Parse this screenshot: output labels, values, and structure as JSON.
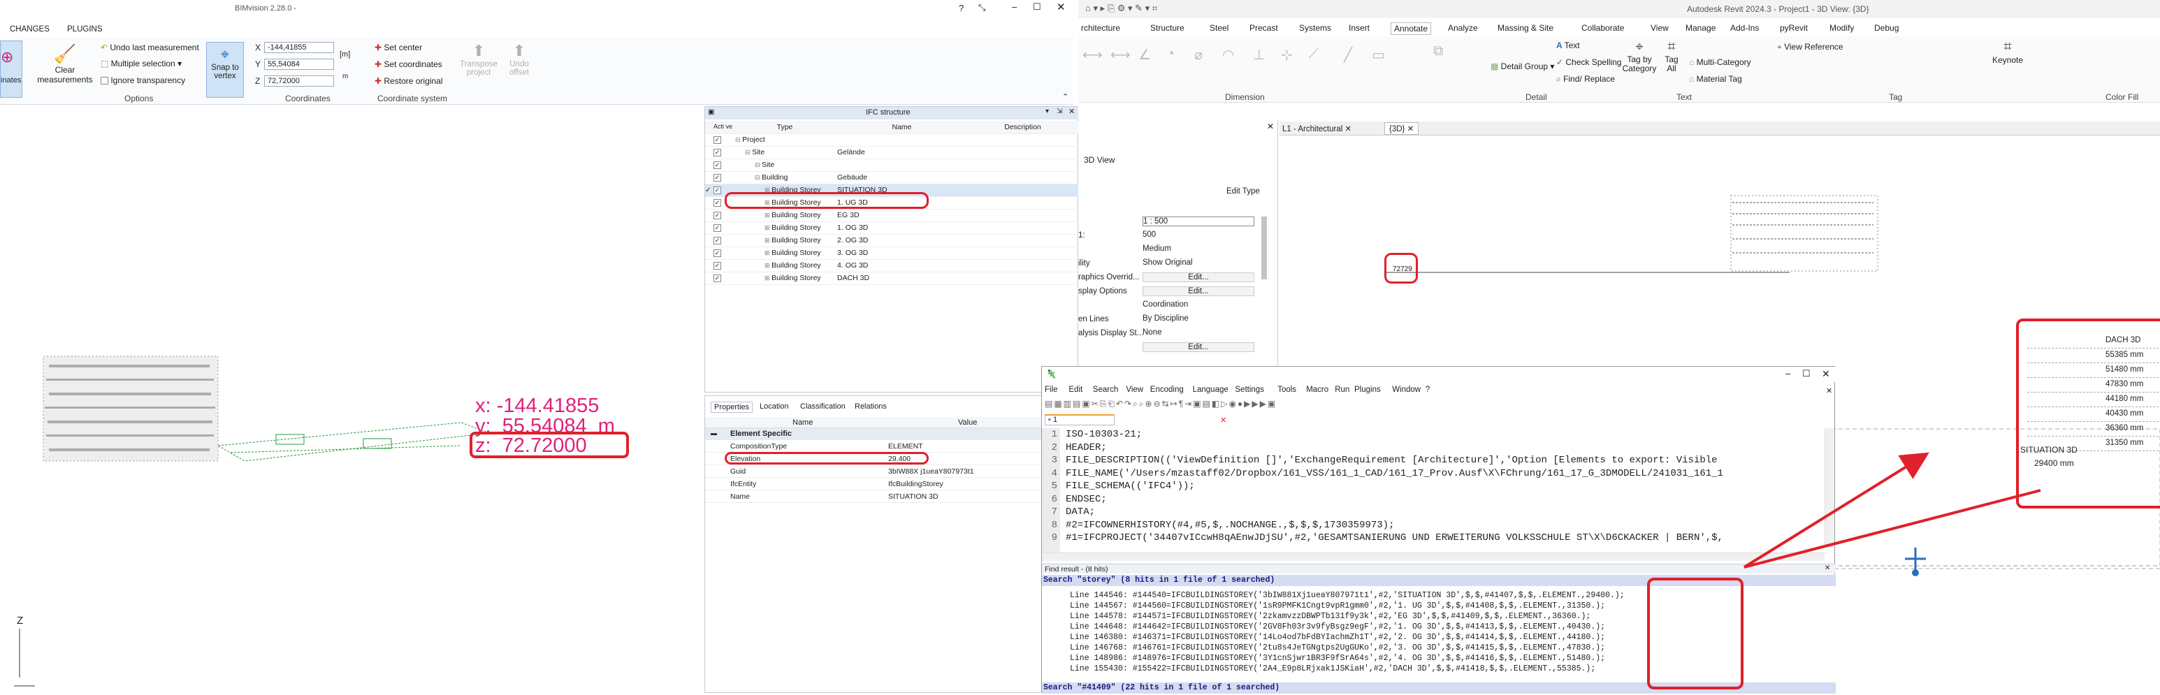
{
  "bim": {
    "title": "BIMvision 2.28.0 -",
    "tabs": [
      "CHANGES",
      "PLUGINS"
    ],
    "win_help": "?",
    "ribbon": {
      "left_cut": "inates",
      "clear_label_1": "Clear",
      "clear_label_2": "measurements",
      "undo_last": "Undo last measurement",
      "multiple_selection": "Multiple selection",
      "ignore_transparency": "Ignore transparency",
      "snap_1": "Snap to",
      "snap_2": "vertex",
      "options_group": "Options",
      "x_label": "X",
      "y_label": "Y",
      "z_label": "Z",
      "x_value": "-144,41855",
      "y_value": "55,54084",
      "z_value": "72,72000",
      "unit": "[m]",
      "unit2": "m",
      "coords_group": "Coordinates",
      "set_center": "Set center",
      "set_coordinates": "Set coordinates",
      "restore_original": "Restore original",
      "transpose_1": "Transpose",
      "transpose_2": "project",
      "undo_offset_1": "Undo",
      "undo_offset_2": "offset",
      "coord_system_group": "Coordinate system"
    },
    "viewport": {
      "coord_x": "x: -144.41855",
      "coord_y": "y:  55.54084  m",
      "coord_z": "z:  72.72000",
      "axis_z": "Z"
    }
  },
  "ifc_structure": {
    "title": "IFC structure",
    "headers": [
      "Acti ve",
      "Type",
      "Name",
      "Description"
    ],
    "rows": [
      {
        "type": "Project",
        "name": "",
        "indent": 0
      },
      {
        "type": "Site",
        "name": "Gelände",
        "indent": 1
      },
      {
        "type": "Site",
        "name": "",
        "indent": 2
      },
      {
        "type": "Building",
        "name": "Gebäude",
        "indent": 2
      },
      {
        "type": "Building Storey",
        "name": "SITUATION 3D",
        "indent": 3
      },
      {
        "type": "Building Storey",
        "name": "1. UG 3D",
        "indent": 3
      },
      {
        "type": "Building Storey",
        "name": "EG 3D",
        "indent": 3
      },
      {
        "type": "Building Storey",
        "name": "1. OG 3D",
        "indent": 3
      },
      {
        "type": "Building Storey",
        "name": "2. OG 3D",
        "indent": 3
      },
      {
        "type": "Building Storey",
        "name": "3. OG 3D",
        "indent": 3
      },
      {
        "type": "Building Storey",
        "name": "4. OG 3D",
        "indent": 3
      },
      {
        "type": "Building Storey",
        "name": "DACH 3D",
        "indent": 3
      }
    ]
  },
  "properties": {
    "tabs": [
      "Properties",
      "Location",
      "Classification",
      "Relations"
    ],
    "headers": [
      "Name",
      "Value"
    ],
    "group": "Element Specific",
    "rows": [
      {
        "name": "CompositionType",
        "value": "ELEMENT"
      },
      {
        "name": "Elevation",
        "value": "29.400"
      },
      {
        "name": "Guid",
        "value": "3bIW88X j1ueaY807973t1"
      },
      {
        "name": "IfcEntity",
        "value": "IfcBuildingStorey"
      },
      {
        "name": "Name",
        "value": "SITUATION 3D"
      }
    ]
  },
  "revit": {
    "title": "Autodesk Revit 2024.3 - Project1 - 3D View: {3D}",
    "menu": [
      "rchitecture",
      "Structure",
      "Steel",
      "Precast",
      "Systems",
      "Insert",
      "Annotate",
      "Analyze",
      "Massing & Site",
      "Collaborate",
      "View",
      "Manage",
      "Add-Ins",
      "pyRevit",
      "Modify",
      "Debug"
    ],
    "ribbon_tags": [
      "Tag by Category",
      "Tag All",
      "Multi-Category",
      "Material Tag",
      "Keynote"
    ],
    "ribbon_text": [
      "Text",
      "Check Spelling",
      "Find/ Replace",
      "View Reference"
    ],
    "detail_group": "Detail Group",
    "group_labels": [
      "Dimension",
      "Detail",
      "Text",
      "Tag",
      "Color Fill"
    ],
    "view_tabs": [
      "L1 - Architectural",
      "{3D}"
    ],
    "props_type": "3D View",
    "edit_type": "Edit Type",
    "props_rows": [
      {
        "label": "",
        "value": "1 : 500"
      },
      {
        "label": "1:",
        "value": "500"
      },
      {
        "label": "",
        "value": "Medium"
      },
      {
        "label": "ility",
        "value": "Show Original"
      },
      {
        "label": "raphics Overrid...",
        "value": "Edit..."
      },
      {
        "label": "splay Options",
        "value": "Edit..."
      },
      {
        "label": "",
        "value": "Coordination"
      },
      {
        "label": "en Lines",
        "value": "By Discipline"
      },
      {
        "label": "alysis Display St...",
        "value": "None"
      },
      {
        "label": "",
        "value": "Edit..."
      }
    ],
    "spot": "72729",
    "levels": [
      {
        "name": "DACH 3D",
        "elev": ""
      },
      {
        "name": "",
        "elev": "55385 mm"
      },
      {
        "name": "",
        "elev": "51480 mm"
      },
      {
        "name": "",
        "elev": "47830 mm"
      },
      {
        "name": "",
        "elev": "44180 mm"
      },
      {
        "name": "",
        "elev": "40430 mm"
      },
      {
        "name": "",
        "elev": "36360 mm"
      },
      {
        "name": "",
        "elev": "31350 mm"
      }
    ],
    "situation_name": "SITUATION 3D",
    "situation_elev": "29400 mm"
  },
  "notepad": {
    "menu": [
      "File",
      "Edit",
      "Search",
      "View",
      "Encoding",
      "Language",
      "Settings",
      "Tools",
      "Macro",
      "Run",
      "Plugins",
      "Window",
      "?"
    ],
    "tab": "1",
    "lines": [
      "ISO-10303-21;",
      "HEADER;",
      "FILE_DESCRIPTION(('ViewDefinition []','ExchangeRequirement [Architecture]','Option [Elements to export: Visible",
      "FILE_NAME('/Users/mzastaff02/Dropbox/161_VSS/161_1_CAD/161_17_Prov.Ausf\\X\\FChrung/161_17_G_3DMODELL/241031_161_1",
      "FILE_SCHEMA(('IFC4'));",
      "ENDSEC;",
      "DATA;",
      "#2=IFCOWNERHISTORY(#4,#5,$,.NOCHANGE.,$,$,$,1730359973);",
      "#1=IFCPROJECT('34407vICcwH8qAEnwJDjSU',#2,'GESAMTSANIERUNG UND ERWEITERUNG VOLKSSCHULE ST\\X\\D6CKACKER | BERN',$,"
    ],
    "find_title": "Find result - (8 hits)",
    "search_header": "Search \"storey\" (8 hits in 1 file of 1 searched)",
    "hits": [
      "Line 144546: #144540=IFCBUILDINGSTOREY('3bIW881Xj1ueaY807971t1',#2,'SITUATION 3D',$,$,#41407,$,$,.ELEMENT.,29400.);",
      "Line 144567: #144560=IFCBUILDINGSTOREY('1sR9PMFK1Cngt9vpR1gmm0',#2,'1. UG 3D',$,$,#41408,$,$,.ELEMENT.,31350.);",
      "Line 144578: #144571=IFCBUILDINGSTOREY('2zkamvzzDBWPTb131f9y3k',#2,'EG 3D',$,$,#41409,$,$,.ELEMENT.,36360.);",
      "Line 144648: #144642=IFCBUILDINGSTOREY('2GV8Fh03r3v9fyBsgz9egF',#2,'1. OG 3D',$,$,#41413,$,$,.ELEMENT.,40430.);",
      "Line 146380: #146371=IFCBUILDINGSTOREY('14Lo4od7bFdBYIachmZh1T',#2,'2. OG 3D',$,$,#41414,$,$,.ELEMENT.,44180.);",
      "Line 146768: #146761=IFCBUILDINGSTOREY('2tu8s4JeTGNgtps2UgGUKo',#2,'3. OG 3D',$,$,#41415,$,$,.ELEMENT.,47830.);",
      "Line 148986: #148976=IFCBUILDINGSTOREY('3Y1cnSjwr1BR3F9fSrA64s',#2,'4. OG 3D',$,$,#41416,$,$,.ELEMENT.,51480.);",
      "Line 155430: #155422=IFCBUILDINGSTOREY('2A4_E9p8LRjxak1JSKiaH',#2,'DACH 3D',$,$,#41418,$,$,.ELEMENT.,55385.);"
    ],
    "search2_header": "Search \"#41409\" (22 hits in 1 file of 1 searched)"
  },
  "colors": {
    "accent": "#e0202a",
    "bim_blue": "#2a6ebb",
    "coord_text": "#e0207a"
  }
}
